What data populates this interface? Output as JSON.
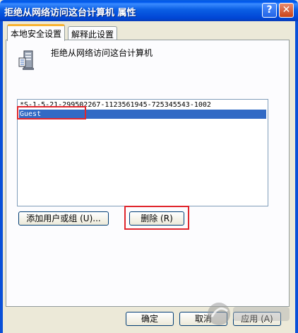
{
  "window": {
    "title": "拒绝从网络访问这台计算机 属性",
    "help_label": "?",
    "close_label": "✕"
  },
  "tabs": [
    {
      "label": "本地安全设置",
      "active": true
    },
    {
      "label": "解释此设置",
      "active": false
    }
  ],
  "policy": {
    "title": "拒绝从网络访问这台计算机",
    "icon": "server-policy-icon"
  },
  "list": {
    "items": [
      {
        "label": "*S-1-5-21-299502267-1123561945-725345543-1002",
        "selected": false
      },
      {
        "label": "Guest",
        "selected": true
      }
    ]
  },
  "buttons": {
    "add_label": "添加用户或组 (U)...",
    "remove_label": "删除 (R)",
    "ok_label": "确定",
    "cancel_label": "取消",
    "apply_label": "应用 (A)"
  },
  "colors": {
    "highlight": "#e0262d",
    "selection": "#316ac5"
  }
}
